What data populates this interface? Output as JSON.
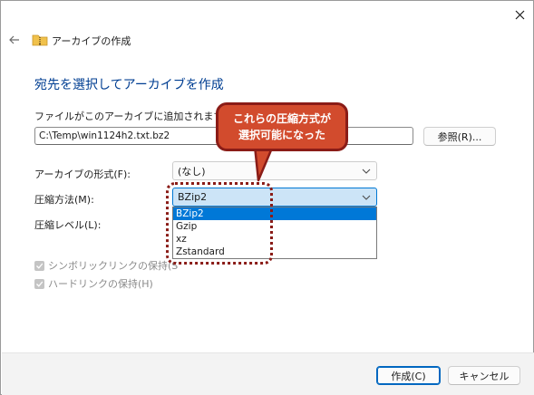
{
  "window": {
    "title": "アーカイブの作成",
    "close_icon": "close-icon",
    "back_icon": "arrow-left-icon",
    "folder_icon": "folder-zip-icon"
  },
  "main": {
    "heading": "宛先を選択してアーカイブを作成",
    "file_label": "ファイルがこのアーカイブに追加されます(A)",
    "file_path": "C:\\Temp\\win1124h2.txt.bz2",
    "browse_label": "参照(R)...",
    "format_label": "アーカイブの形式(F):",
    "format_value": "(なし)",
    "compression_label": "圧縮方法(M):",
    "compression_value": "BZip2",
    "compression_options": [
      "BZip2",
      "Gzip",
      "xz",
      "Zstandard"
    ],
    "level_label": "圧縮レベル(L):",
    "symlink_label": "シンボリックリンクの保持(S",
    "hardlink_label": "ハードリンクの保持(H)"
  },
  "footer": {
    "create_label": "作成(C)",
    "cancel_label": "キャンセル"
  },
  "annotation": {
    "line1": "これらの圧縮方式が",
    "line2": "選択可能になった",
    "color": "#d24b2d",
    "border_color": "#8a1c17"
  },
  "colors": {
    "accent": "#0078d7",
    "heading": "#003e92"
  }
}
